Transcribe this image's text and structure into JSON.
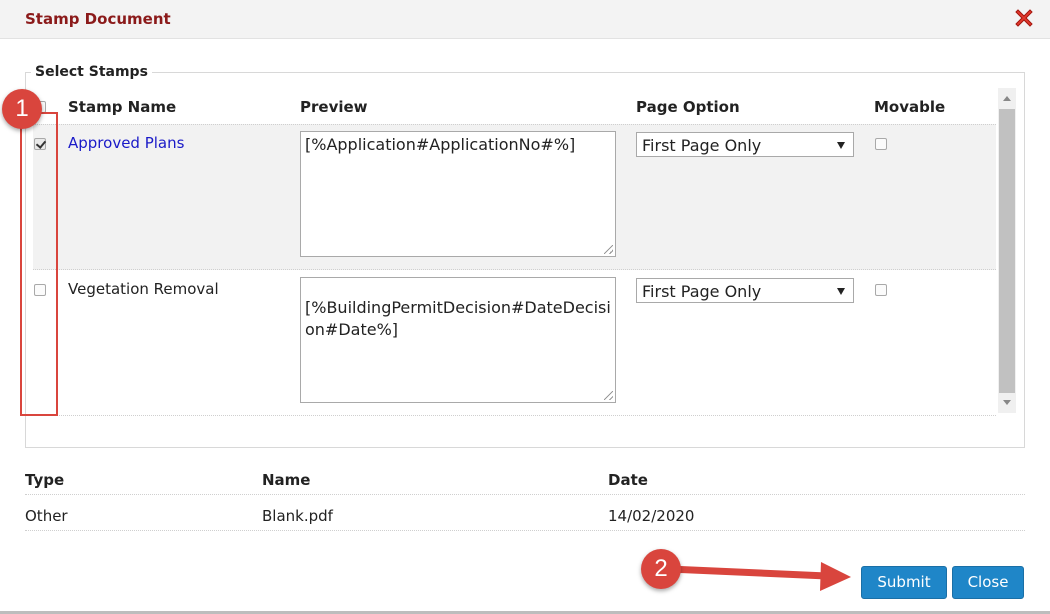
{
  "dialog": {
    "title": "Stamp Document",
    "close_icon": "close-x-icon"
  },
  "stamps": {
    "legend": "Select Stamps",
    "headers": {
      "name": "Stamp Name",
      "preview": "Preview",
      "page_option": "Page Option",
      "movable": "Movable"
    },
    "rows": [
      {
        "name": "Approved Plans",
        "selected": true,
        "preview": "[%Application#ApplicationNo#%]",
        "page_option": "First Page Only",
        "movable": false
      },
      {
        "name": "Vegetation Removal",
        "selected": false,
        "preview": "[%BuildingPermitDecision#DateDecision#Date%]",
        "page_option": "First Page Only",
        "movable": false
      }
    ]
  },
  "document": {
    "headers": {
      "type": "Type",
      "name": "Name",
      "date": "Date"
    },
    "rows": [
      {
        "type": "Other",
        "name": "Blank.pdf",
        "date": "14/02/2020"
      }
    ]
  },
  "buttons": {
    "submit": "Submit",
    "close": "Close"
  },
  "annotations": {
    "badge_1": "1",
    "badge_2": "2",
    "color": "#d9453d"
  },
  "colors": {
    "title": "#8b1a1a",
    "link": "#1a1ac8",
    "button": "#1f86c8"
  }
}
